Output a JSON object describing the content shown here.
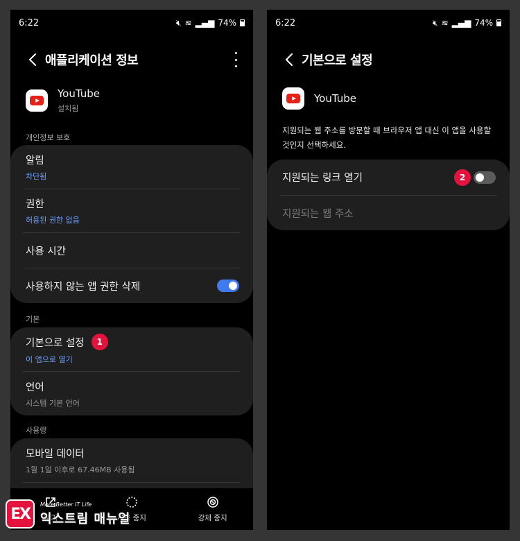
{
  "left": {
    "status_time": "6:22",
    "status_battery": "74%",
    "title": "애플리케이션 정보",
    "app_name": "YouTube",
    "app_status": "설치됨",
    "privacy_label": "개인정보 보호",
    "privacy_rows": [
      {
        "main": "알림",
        "sub": "차단됨"
      },
      {
        "main": "권한",
        "sub": "허용된 권한 없음"
      },
      {
        "main": "사용 시간"
      },
      {
        "main": "사용하지 않는 앱 권한 삭제",
        "toggle": true
      }
    ],
    "default_label": "기본",
    "default_rows": [
      {
        "main": "기본으로 설정",
        "sub": "이 앱으로 열기",
        "badge": "1"
      },
      {
        "main": "언어",
        "sub": "시스템 기본 언어"
      }
    ],
    "usage_label": "사용량",
    "usage_rows": [
      {
        "main": "모바일 데이터",
        "sub": "1월 1일 이후로 67.46MB 사용됨"
      }
    ],
    "nav": [
      {
        "label": "열기",
        "icon": "open-icon"
      },
      {
        "label": "사용 중지",
        "icon": "disable-icon"
      },
      {
        "label": "강제 중지",
        "icon": "force-stop-icon"
      }
    ]
  },
  "right": {
    "status_time": "6:22",
    "status_battery": "74%",
    "title": "기본으로 설정",
    "app_name": "YouTube",
    "description": "지원되는 웹 주소를 방문할 때 브라우저 앱 대신 이 앱을 사용할 것인지 선택하세요.",
    "open_links_label": "지원되는 링크 열기",
    "open_links_badge": "2",
    "open_links_toggle": false,
    "supported_urls_label": "지원되는 웹 주소"
  },
  "watermark": {
    "logo": "EX",
    "tagline": "More Better IT Life",
    "brand": "익스트림 매뉴얼"
  },
  "colors": {
    "accent_blue": "#3f7bf0",
    "link_blue": "#6d9ef7",
    "badge_red": "#e3133e",
    "youtube_red": "#e62117"
  }
}
